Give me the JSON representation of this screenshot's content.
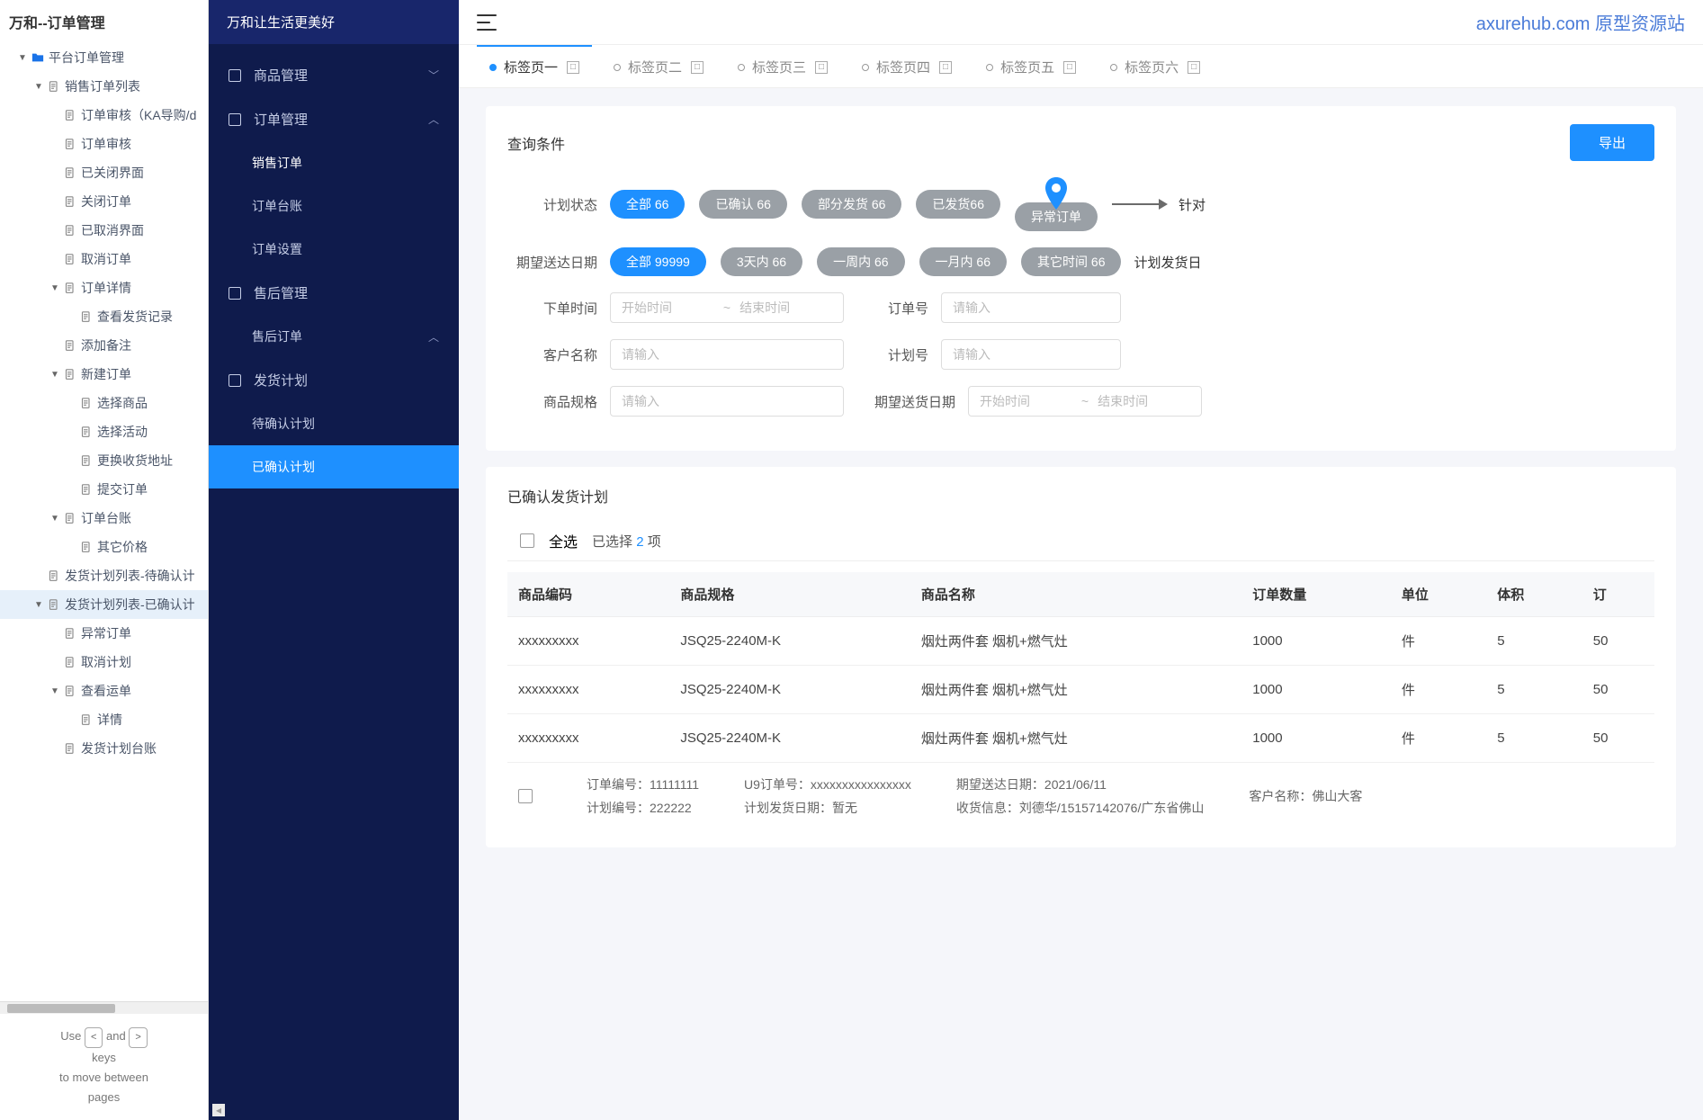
{
  "tree": {
    "title": "万和--订单管理",
    "items": [
      {
        "label": "平台订单管理",
        "indent": 1,
        "toggle": "▼",
        "icon": "folder"
      },
      {
        "label": "销售订单列表",
        "indent": 2,
        "toggle": "▼",
        "icon": "page"
      },
      {
        "label": "订单审核（KA导购/d",
        "indent": 3,
        "icon": "page"
      },
      {
        "label": "订单审核",
        "indent": 3,
        "icon": "page"
      },
      {
        "label": "已关闭界面",
        "indent": 3,
        "icon": "page"
      },
      {
        "label": "关闭订单",
        "indent": 3,
        "icon": "page"
      },
      {
        "label": "已取消界面",
        "indent": 3,
        "icon": "page"
      },
      {
        "label": "取消订单",
        "indent": 3,
        "icon": "page"
      },
      {
        "label": "订单详情",
        "indent": 3,
        "toggle": "▼",
        "icon": "page"
      },
      {
        "label": "查看发货记录",
        "indent": 4,
        "icon": "page"
      },
      {
        "label": "添加备注",
        "indent": 3,
        "icon": "page"
      },
      {
        "label": "新建订单",
        "indent": 3,
        "toggle": "▼",
        "icon": "page"
      },
      {
        "label": "选择商品",
        "indent": 4,
        "icon": "page"
      },
      {
        "label": "选择活动",
        "indent": 4,
        "icon": "page"
      },
      {
        "label": "更换收货地址",
        "indent": 4,
        "icon": "page"
      },
      {
        "label": "提交订单",
        "indent": 4,
        "icon": "page"
      },
      {
        "label": "订单台账",
        "indent": 3,
        "toggle": "▼",
        "icon": "page"
      },
      {
        "label": "其它价格",
        "indent": 4,
        "icon": "page"
      },
      {
        "label": "发货计划列表-待确认计",
        "indent": 2,
        "icon": "page"
      },
      {
        "label": "发货计划列表-已确认计",
        "indent": 2,
        "toggle": "▼",
        "icon": "page",
        "selected": true
      },
      {
        "label": "异常订单",
        "indent": 3,
        "icon": "page"
      },
      {
        "label": "取消计划",
        "indent": 3,
        "icon": "page"
      },
      {
        "label": "查看运单",
        "indent": 3,
        "toggle": "▼",
        "icon": "page"
      },
      {
        "label": "详情",
        "indent": 4,
        "icon": "page"
      },
      {
        "label": "发货计划台账",
        "indent": 3,
        "icon": "page"
      }
    ],
    "hint": {
      "use": "Use",
      "and": "and",
      "keys": "keys",
      "move": "to move between",
      "pages": "pages",
      "left": "<",
      "right": ">"
    }
  },
  "sidebar": {
    "brand": "万和让生活更美好",
    "items": [
      {
        "label": "商品管理",
        "arrow": "﹀",
        "icon": true
      },
      {
        "label": "订单管理",
        "arrow": "︿",
        "icon": true
      },
      {
        "label": "销售订单",
        "sub": true,
        "highlight": true
      },
      {
        "label": "订单台账",
        "sub": true
      },
      {
        "label": "订单设置",
        "sub": true
      },
      {
        "label": "售后管理",
        "icon": true
      },
      {
        "label": "售后订单",
        "sub": true,
        "arrow": "︿"
      },
      {
        "label": "发货计划",
        "icon": true
      },
      {
        "label": "待确认计划",
        "sub": true
      },
      {
        "label": "已确认计划",
        "sub": true,
        "active": true
      }
    ]
  },
  "header": {
    "link": "axurehub.com 原型资源站"
  },
  "tabs": [
    {
      "label": "标签页一",
      "active": true
    },
    {
      "label": "标签页二"
    },
    {
      "label": "标签页三"
    },
    {
      "label": "标签页四"
    },
    {
      "label": "标签页五"
    },
    {
      "label": "标签页六"
    }
  ],
  "query": {
    "title": "查询条件",
    "export": "导出",
    "planStatus": {
      "label": "计划状态",
      "options": [
        {
          "text": "全部  66",
          "active": true
        },
        {
          "text": "已确认  66"
        },
        {
          "text": "部分发货 66"
        },
        {
          "text": "已发货66"
        },
        {
          "text": "异常订单",
          "pointer": true
        }
      ],
      "tail": "针对"
    },
    "expectDate": {
      "label": "期望送达日期",
      "options": [
        {
          "text": "全部  99999",
          "active": true
        },
        {
          "text": "3天内  66"
        },
        {
          "text": "一周内  66"
        },
        {
          "text": "一月内  66"
        },
        {
          "text": "其它时间  66"
        }
      ],
      "tail": "计划发货日"
    },
    "orderTime": {
      "label": "下单时间",
      "start": "开始时间",
      "end": "结束时间"
    },
    "orderNo": {
      "label": "订单号",
      "ph": "请输入"
    },
    "customer": {
      "label": "客户名称",
      "ph": "请输入"
    },
    "planNo": {
      "label": "计划号",
      "ph": "请输入"
    },
    "spec": {
      "label": "商品规格",
      "ph": "请输入"
    },
    "expectRange": {
      "label": "期望送货日期",
      "start": "开始时间",
      "end": "结束时间"
    }
  },
  "list": {
    "title": "已确认发货计划",
    "selectAll": "全选",
    "selectedPrefix": "已选择 ",
    "selectedNum": "2",
    "selectedSuffix": " 项",
    "cols": [
      "商品编码",
      "商品规格",
      "商品名称",
      "订单数量",
      "单位",
      "体积",
      "订"
    ],
    "rows": [
      {
        "code": "xxxxxxxxx",
        "spec": "JSQ25-2240M-K",
        "name": "烟灶两件套 烟机+燃气灶",
        "qty": "1000",
        "unit": "件",
        "vol": "5",
        "last": "50"
      },
      {
        "code": "xxxxxxxxx",
        "spec": "JSQ25-2240M-K",
        "name": "烟灶两件套 烟机+燃气灶",
        "qty": "1000",
        "unit": "件",
        "vol": "5",
        "last": "50"
      },
      {
        "code": "xxxxxxxxx",
        "spec": "JSQ25-2240M-K",
        "name": "烟灶两件套 烟机+燃气灶",
        "qty": "1000",
        "unit": "件",
        "vol": "5",
        "last": "50"
      }
    ],
    "meta": {
      "orderNo": "订单编号：11111111",
      "u9": "U9订单号：xxxxxxxxxxxxxxxx",
      "expect": "期望送达日期：2021/06/11",
      "customer": "客户名称：佛山大客",
      "planNo": "计划编号：222222",
      "planDate": "计划发货日期：暂无",
      "receive": "收货信息：刘德华/15157142076/广东省佛山"
    }
  }
}
